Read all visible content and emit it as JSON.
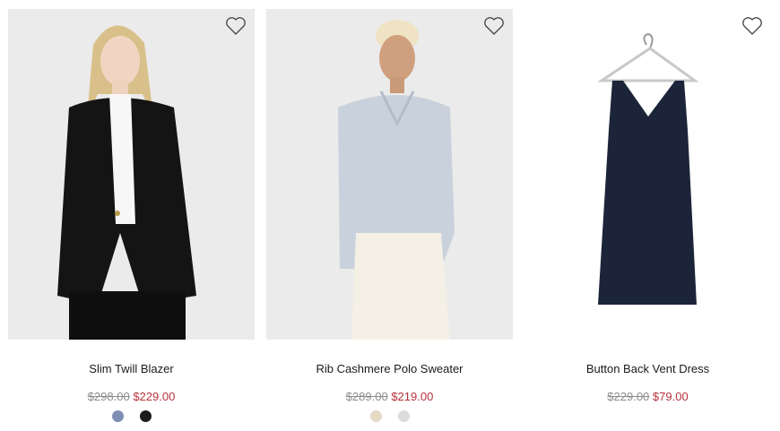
{
  "products": [
    {
      "name": "Slim Twill Blazer",
      "original_price": "$298.00",
      "sale_price": "$229.00",
      "swatches": [
        "#7f8eb5",
        "#1b1b1b"
      ]
    },
    {
      "name": "Rib Cashmere Polo Sweater",
      "original_price": "$289.00",
      "sale_price": "$219.00",
      "swatches": [
        "#e6d9c8",
        "#dcdcdc"
      ]
    },
    {
      "name": "Button Back Vent Dress",
      "original_price": "$229.00",
      "sale_price": "$79.00",
      "swatches": []
    }
  ],
  "colors": {
    "sale": "#b8323c",
    "original": "#8c8c8c"
  },
  "icons": {
    "wishlist": "heart-icon"
  }
}
